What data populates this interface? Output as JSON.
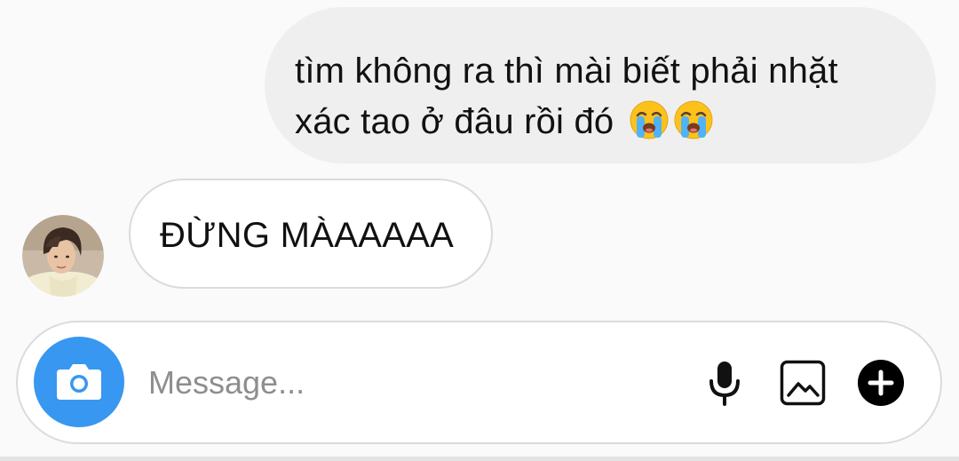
{
  "messages": {
    "outgoing": {
      "line1": "tìm không ra thì mài biết phải nhặt",
      "line2": "xác tao ở đâu rồi đó",
      "emojis": [
        "loudly-crying-face",
        "loudly-crying-face"
      ]
    },
    "incoming": {
      "text": "ĐỪNG MÀAAAAA"
    }
  },
  "composer": {
    "placeholder": "Message...",
    "value": "",
    "icons": [
      "camera-icon",
      "microphone-icon",
      "photo-gallery-icon",
      "plus-icon"
    ]
  },
  "colors": {
    "background": "#fafafa",
    "outgoing_bubble": "#efefef",
    "incoming_border": "#dbdbdb",
    "camera_button": "#3897f0",
    "placeholder": "#8e8e8e"
  }
}
